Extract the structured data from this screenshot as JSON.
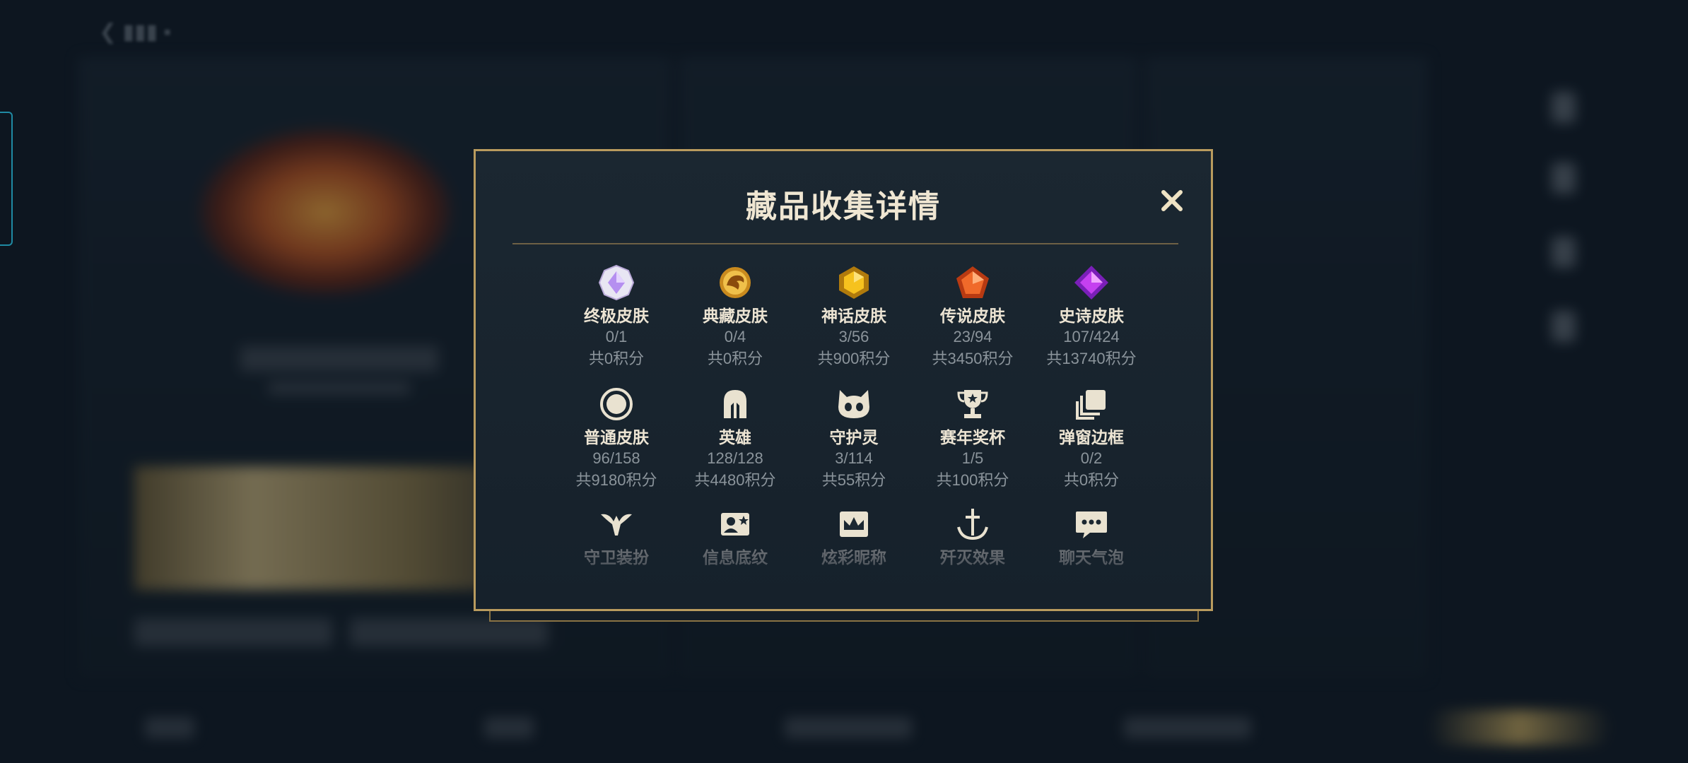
{
  "modal": {
    "title": "藏品收集详情",
    "close_label": "✕"
  },
  "colors": {
    "accent_gold": "#b99b5e",
    "modal_bg": "#1b2731",
    "title_text": "#efe6d2",
    "secondary_text": "#8b949b"
  },
  "categories": [
    {
      "name": "终极皮肤",
      "count": "0/1",
      "points": "共0积分",
      "icon": "ultimate-gem-icon"
    },
    {
      "name": "典藏皮肤",
      "count": "0/4",
      "points": "共0积分",
      "icon": "prestige-dragon-icon"
    },
    {
      "name": "神话皮肤",
      "count": "3/56",
      "points": "共900积分",
      "icon": "mythic-gem-icon"
    },
    {
      "name": "传说皮肤",
      "count": "23/94",
      "points": "共3450积分",
      "icon": "legendary-gem-icon"
    },
    {
      "name": "史诗皮肤",
      "count": "107/424",
      "points": "共13740积分",
      "icon": "epic-gem-icon"
    },
    {
      "name": "普通皮肤",
      "count": "96/158",
      "points": "共9180积分",
      "icon": "standard-circle-icon"
    },
    {
      "name": "英雄",
      "count": "128/128",
      "points": "共4480积分",
      "icon": "helmet-icon"
    },
    {
      "name": "守护灵",
      "count": "3/114",
      "points": "共55积分",
      "icon": "spirit-face-icon"
    },
    {
      "name": "赛年奖杯",
      "count": "1/5",
      "points": "共100积分",
      "icon": "trophy-icon"
    },
    {
      "name": "弹窗边框",
      "count": "0/2",
      "points": "共0积分",
      "icon": "stacked-frames-icon"
    },
    {
      "name": "守卫装扮",
      "icon": "ward-icon"
    },
    {
      "name": "信息底纹",
      "icon": "info-card-icon"
    },
    {
      "name": "炫彩昵称",
      "icon": "crown-card-icon"
    },
    {
      "name": "歼灭效果",
      "icon": "anchor-sword-icon"
    },
    {
      "name": "聊天气泡",
      "icon": "chat-bubble-icon"
    }
  ]
}
